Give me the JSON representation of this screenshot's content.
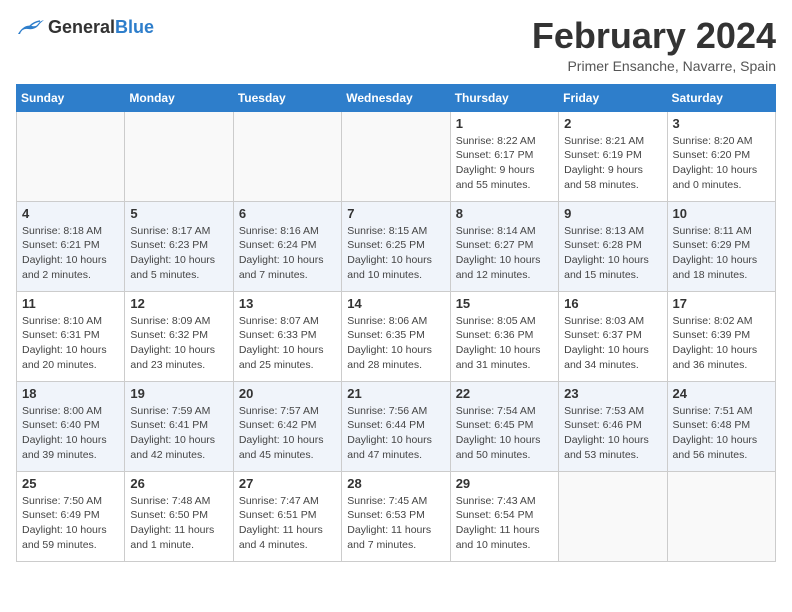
{
  "logo": {
    "general": "General",
    "blue": "Blue"
  },
  "header": {
    "title": "February 2024",
    "subtitle": "Primer Ensanche, Navarre, Spain"
  },
  "weekdays": [
    "Sunday",
    "Monday",
    "Tuesday",
    "Wednesday",
    "Thursday",
    "Friday",
    "Saturday"
  ],
  "weeks": [
    [
      {
        "day": "",
        "info": ""
      },
      {
        "day": "",
        "info": ""
      },
      {
        "day": "",
        "info": ""
      },
      {
        "day": "",
        "info": ""
      },
      {
        "day": "1",
        "info": "Sunrise: 8:22 AM\nSunset: 6:17 PM\nDaylight: 9 hours\nand 55 minutes."
      },
      {
        "day": "2",
        "info": "Sunrise: 8:21 AM\nSunset: 6:19 PM\nDaylight: 9 hours\nand 58 minutes."
      },
      {
        "day": "3",
        "info": "Sunrise: 8:20 AM\nSunset: 6:20 PM\nDaylight: 10 hours\nand 0 minutes."
      }
    ],
    [
      {
        "day": "4",
        "info": "Sunrise: 8:18 AM\nSunset: 6:21 PM\nDaylight: 10 hours\nand 2 minutes."
      },
      {
        "day": "5",
        "info": "Sunrise: 8:17 AM\nSunset: 6:23 PM\nDaylight: 10 hours\nand 5 minutes."
      },
      {
        "day": "6",
        "info": "Sunrise: 8:16 AM\nSunset: 6:24 PM\nDaylight: 10 hours\nand 7 minutes."
      },
      {
        "day": "7",
        "info": "Sunrise: 8:15 AM\nSunset: 6:25 PM\nDaylight: 10 hours\nand 10 minutes."
      },
      {
        "day": "8",
        "info": "Sunrise: 8:14 AM\nSunset: 6:27 PM\nDaylight: 10 hours\nand 12 minutes."
      },
      {
        "day": "9",
        "info": "Sunrise: 8:13 AM\nSunset: 6:28 PM\nDaylight: 10 hours\nand 15 minutes."
      },
      {
        "day": "10",
        "info": "Sunrise: 8:11 AM\nSunset: 6:29 PM\nDaylight: 10 hours\nand 18 minutes."
      }
    ],
    [
      {
        "day": "11",
        "info": "Sunrise: 8:10 AM\nSunset: 6:31 PM\nDaylight: 10 hours\nand 20 minutes."
      },
      {
        "day": "12",
        "info": "Sunrise: 8:09 AM\nSunset: 6:32 PM\nDaylight: 10 hours\nand 23 minutes."
      },
      {
        "day": "13",
        "info": "Sunrise: 8:07 AM\nSunset: 6:33 PM\nDaylight: 10 hours\nand 25 minutes."
      },
      {
        "day": "14",
        "info": "Sunrise: 8:06 AM\nSunset: 6:35 PM\nDaylight: 10 hours\nand 28 minutes."
      },
      {
        "day": "15",
        "info": "Sunrise: 8:05 AM\nSunset: 6:36 PM\nDaylight: 10 hours\nand 31 minutes."
      },
      {
        "day": "16",
        "info": "Sunrise: 8:03 AM\nSunset: 6:37 PM\nDaylight: 10 hours\nand 34 minutes."
      },
      {
        "day": "17",
        "info": "Sunrise: 8:02 AM\nSunset: 6:39 PM\nDaylight: 10 hours\nand 36 minutes."
      }
    ],
    [
      {
        "day": "18",
        "info": "Sunrise: 8:00 AM\nSunset: 6:40 PM\nDaylight: 10 hours\nand 39 minutes."
      },
      {
        "day": "19",
        "info": "Sunrise: 7:59 AM\nSunset: 6:41 PM\nDaylight: 10 hours\nand 42 minutes."
      },
      {
        "day": "20",
        "info": "Sunrise: 7:57 AM\nSunset: 6:42 PM\nDaylight: 10 hours\nand 45 minutes."
      },
      {
        "day": "21",
        "info": "Sunrise: 7:56 AM\nSunset: 6:44 PM\nDaylight: 10 hours\nand 47 minutes."
      },
      {
        "day": "22",
        "info": "Sunrise: 7:54 AM\nSunset: 6:45 PM\nDaylight: 10 hours\nand 50 minutes."
      },
      {
        "day": "23",
        "info": "Sunrise: 7:53 AM\nSunset: 6:46 PM\nDaylight: 10 hours\nand 53 minutes."
      },
      {
        "day": "24",
        "info": "Sunrise: 7:51 AM\nSunset: 6:48 PM\nDaylight: 10 hours\nand 56 minutes."
      }
    ],
    [
      {
        "day": "25",
        "info": "Sunrise: 7:50 AM\nSunset: 6:49 PM\nDaylight: 10 hours\nand 59 minutes."
      },
      {
        "day": "26",
        "info": "Sunrise: 7:48 AM\nSunset: 6:50 PM\nDaylight: 11 hours\nand 1 minute."
      },
      {
        "day": "27",
        "info": "Sunrise: 7:47 AM\nSunset: 6:51 PM\nDaylight: 11 hours\nand 4 minutes."
      },
      {
        "day": "28",
        "info": "Sunrise: 7:45 AM\nSunset: 6:53 PM\nDaylight: 11 hours\nand 7 minutes."
      },
      {
        "day": "29",
        "info": "Sunrise: 7:43 AM\nSunset: 6:54 PM\nDaylight: 11 hours\nand 10 minutes."
      },
      {
        "day": "",
        "info": ""
      },
      {
        "day": "",
        "info": ""
      }
    ]
  ]
}
